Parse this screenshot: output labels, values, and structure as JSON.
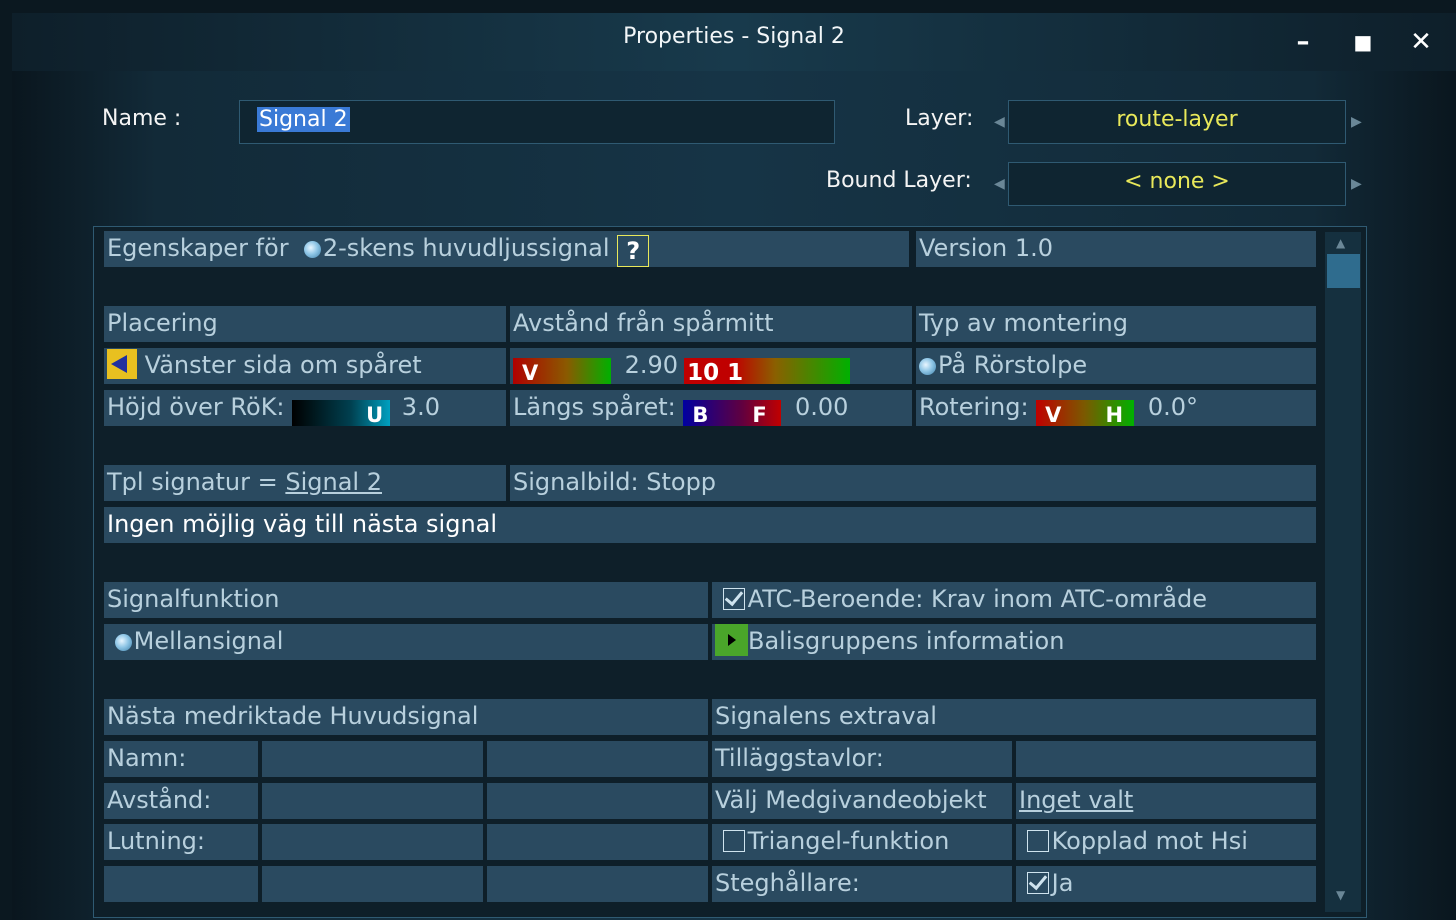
{
  "window": {
    "title": "Properties - Signal 2"
  },
  "header": {
    "name_label": "Name :",
    "name_value_selected": "Signal 2",
    "layer_label": "Layer:",
    "layer_value": "route-layer",
    "bound_layer_label": "Bound Layer:",
    "bound_layer_value": "< none >"
  },
  "props": {
    "egenskaper_label": "Egenskaper för",
    "signal_type": "2-skens huvudljussignal",
    "help": "?",
    "version": "Version 1.0",
    "placering": "Placering",
    "avstand_header": "Avstånd från spårmitt",
    "typ_montering": "Typ av montering",
    "side": "Vänster sida om spåret",
    "avstand_v": "V",
    "avstand_value": "2.90",
    "avstand_box": "10 1",
    "montering": "På Rörstolpe",
    "hojd_label": "Höjd över RöK:",
    "hojd_u": "U",
    "hojd_value": "3.0",
    "langs_label": "Längs spåret:",
    "langs_b": "B",
    "langs_f": "F",
    "langs_value": "0.00",
    "rot_label": "Rotering:",
    "rot_v": "V",
    "rot_h": "H",
    "rot_value": "0.0°",
    "tpl_label": "Tpl signatur = ",
    "tpl_link": "Signal 2",
    "signalbild": "Signalbild: Stopp",
    "no_route": "Ingen möjlig väg till nästa signal",
    "signalfunktion": "Signalfunktion",
    "atc": "ATC-Beroende:  Krav inom ATC-område",
    "mellansignal": "Mellansignal",
    "balis": "Balisgruppens information",
    "nasta": "Nästa medriktade Huvudsignal",
    "extraval": "Signalens extraval",
    "namn": "Namn:",
    "tillagg": "Tilläggstavlor:",
    "avstand2": "Avstånd:",
    "medgiv": "Välj Medgivandeobjekt",
    "inget": "Inget valt",
    "lutning": "Lutning:",
    "triangel": "Triangel-funktion",
    "kopplad": "Kopplad mot Hsi",
    "steg": "Steghållare:",
    "ja": "Ja"
  },
  "colors": {
    "accent_yellow": "#e8e85a",
    "cell_bg": "#2a4a60",
    "cell_text": "#b8d0dd"
  }
}
